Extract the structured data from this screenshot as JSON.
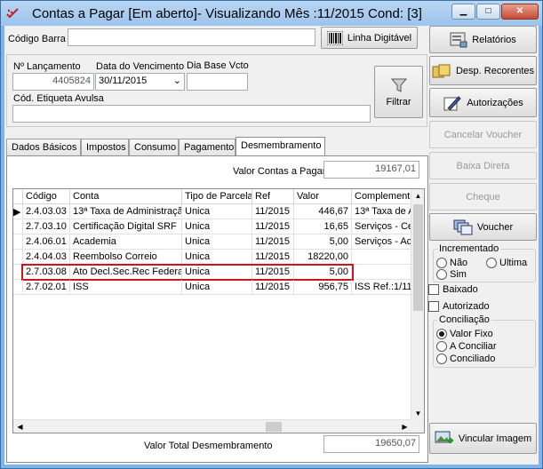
{
  "window": {
    "title": "Contas a Pagar [Em aberto]- Visualizando Mês :11/2015 Cond: [3]"
  },
  "form": {
    "codigo_barra_label": "Código Barra",
    "codigo_barra_value": "",
    "linha_digitavel_label": "Linha Digitável",
    "n_lancamento_label": "Nº Lançamento",
    "n_lancamento_value": "4405824",
    "data_vencimento_label": "Data do Vencimento",
    "data_vencimento_value": "30/11/2015",
    "dia_base_label": "Dia Base Vcto",
    "dia_base_value": "",
    "etiqueta_label": "Cód. Etiqueta Avulsa",
    "etiqueta_value": "",
    "filtrar_label": "Filtrar"
  },
  "tabs": [
    {
      "label": "Dados Básicos"
    },
    {
      "label": "Impostos"
    },
    {
      "label": "Consumo"
    },
    {
      "label": "Pagamento"
    },
    {
      "label": "Desmembramento"
    }
  ],
  "desmembramento": {
    "valor_contas_label": "Valor Contas a Pagar",
    "valor_contas_value": "19167,01",
    "valor_total_label": "Valor Total Desmembramento",
    "valor_total_value": "19650,07",
    "columns": [
      "Código",
      "Conta",
      "Tipo de Parcela",
      "Ref",
      "Valor",
      "Complemento"
    ],
    "rows": [
      {
        "codigo": "2.4.03.03",
        "conta": "13ª Taxa de Administraçã",
        "tipo": "Unica",
        "ref": "11/2015",
        "valor": "446,67",
        "complemento": "13ª Taxa de A"
      },
      {
        "codigo": "2.7.03.10",
        "conta": "Certificação Digital SRF",
        "tipo": "Unica",
        "ref": "11/2015",
        "valor": "16,65",
        "complemento": "Serviços - Cer"
      },
      {
        "codigo": "2.4.06.01",
        "conta": "Academia",
        "tipo": "Unica",
        "ref": "11/2015",
        "valor": "5,00",
        "complemento": "Serviços - Aca"
      },
      {
        "codigo": "2.4.04.03",
        "conta": "Reembolso Correio",
        "tipo": "Unica",
        "ref": "11/2015",
        "valor": "18220,00",
        "complemento": ""
      },
      {
        "codigo": "2.7.03.08",
        "conta": "Ato Decl.Sec.Rec Federa",
        "tipo": "Unica",
        "ref": "11/2015",
        "valor": "5,00",
        "complemento": ""
      },
      {
        "codigo": "2.7.02.01",
        "conta": "ISS",
        "tipo": "Unica",
        "ref": "11/2015",
        "valor": "956,75",
        "complemento": "ISS Ref.:1/11"
      }
    ]
  },
  "sidebar": {
    "relatorios": "Relatórios",
    "desp_recorrentes": "Desp. Recorentes",
    "autorizacoes": "Autorizações",
    "cancelar_voucher": "Cancelar Voucher",
    "baixa_direta": "Baixa Direta",
    "cheque": "Cheque",
    "voucher": "Voucher",
    "incrementado_title": "Incrementado",
    "nao": "Não",
    "ultima": "Ultima",
    "sim": "Sim",
    "baixado": "Baixado",
    "autorizado": "Autorizado",
    "conciliacao_title": "Conciliação",
    "valor_fixo": "Valor Fixo",
    "a_conciliar": "A Conciliar",
    "conciliado": "Conciliado",
    "vincular_imagem": "Vincular Imagem"
  },
  "colors": {
    "highlight_border": "#d0141e",
    "title_bar": "#9cc3ec"
  }
}
